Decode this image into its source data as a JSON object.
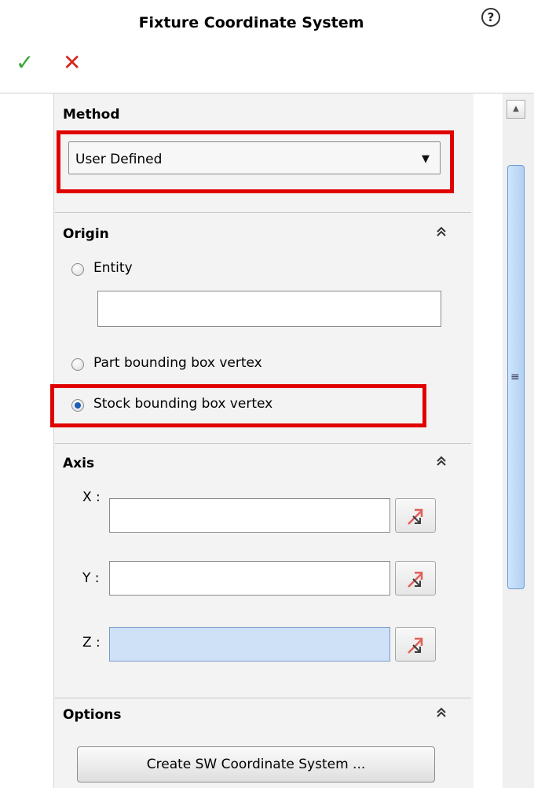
{
  "header": {
    "title": "Fixture Coordinate System",
    "help_glyph": "?",
    "ok_glyph": "✓",
    "cancel_glyph": "✕"
  },
  "method": {
    "label": "Method",
    "selected": "User Defined",
    "arrow": "▼"
  },
  "origin": {
    "label": "Origin",
    "collapse_glyph": "≈",
    "options": [
      {
        "label": "Entity",
        "selected": false
      },
      {
        "label": "Part bounding box vertex",
        "selected": false
      },
      {
        "label": "Stock bounding box vertex",
        "selected": true
      }
    ],
    "entity_value": ""
  },
  "axis": {
    "label": "Axis",
    "collapse_glyph": "≈",
    "rows": [
      {
        "label": "X :",
        "value": ""
      },
      {
        "label": "Y :",
        "value": ""
      },
      {
        "label": "Z :",
        "value": ""
      }
    ]
  },
  "options": {
    "label": "Options",
    "collapse_glyph": "≈",
    "create_button": "Create SW Coordinate System ..."
  },
  "scrollbar": {
    "up_glyph": "▲",
    "grip_glyph": "≡"
  },
  "colors": {
    "highlight": "#e00000",
    "ok": "#3aa635",
    "cancel": "#d6261d",
    "active_field": "#cfe1f7"
  },
  "icons": {
    "pick_direction": "reverse-direction-icon"
  }
}
